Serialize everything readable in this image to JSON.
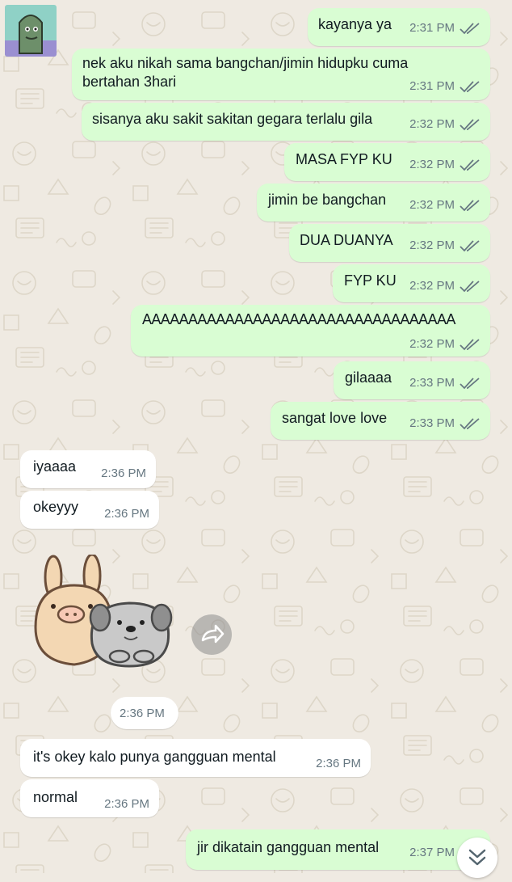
{
  "messages": [
    {
      "id": "m1",
      "dir": "out",
      "text": "kayanya ya",
      "time": "2:31 PM",
      "status": "read"
    },
    {
      "id": "m2",
      "dir": "out",
      "lines": [
        "nek aku nikah sama bangchan/jimin hidupku cuma",
        "bertahan 3hari"
      ],
      "time": "2:31 PM",
      "status": "read"
    },
    {
      "id": "m3",
      "dir": "out",
      "text": "sisanya aku sakit sakitan gegara terlalu gila",
      "time": "2:32 PM",
      "status": "read"
    },
    {
      "id": "m4",
      "dir": "out",
      "text": "MASA FYP KU",
      "time": "2:32 PM",
      "status": "read"
    },
    {
      "id": "m5",
      "dir": "out",
      "text": "jimin be bangchan",
      "time": "2:32 PM",
      "status": "read"
    },
    {
      "id": "m6",
      "dir": "out",
      "text": "DUA DUANYA",
      "time": "2:32 PM",
      "status": "read"
    },
    {
      "id": "m7",
      "dir": "out",
      "text": "FYP KU",
      "time": "2:32 PM",
      "status": "read"
    },
    {
      "id": "m8",
      "dir": "out",
      "text": "AAAAAAAAAAAAAAAAAAAAAAAAAAAAAAAAAA",
      "time": "2:32 PM",
      "status": "read"
    },
    {
      "id": "m9",
      "dir": "out",
      "text": "gilaaaa",
      "time": "2:33 PM",
      "status": "read"
    },
    {
      "id": "m10",
      "dir": "out",
      "text": "sangat love love",
      "time": "2:33 PM",
      "status": "read"
    },
    {
      "id": "m11",
      "dir": "in",
      "text": "iyaaaa",
      "time": "2:36 PM"
    },
    {
      "id": "m12",
      "dir": "in",
      "text": "okeyyy",
      "time": "2:36 PM"
    },
    {
      "id": "m13",
      "dir": "in",
      "type": "sticker",
      "sticker": "bunny-and-dog-sticker",
      "time": "2:36 PM"
    },
    {
      "id": "m14",
      "dir": "in",
      "text": "it's okey kalo punya gangguan mental",
      "time": "2:36 PM"
    },
    {
      "id": "m15",
      "dir": "in",
      "text": "normal",
      "time": "2:36 PM"
    },
    {
      "id": "m16",
      "dir": "out",
      "text": "jir dikatain gangguan mental",
      "time": "2:37 PM",
      "status": "read"
    }
  ],
  "icons": {
    "avatar": "contact-avatar-icon",
    "forward": "forward-icon",
    "scroll": "chevron-double-down-icon",
    "tick": "double-check-icon"
  },
  "colors": {
    "outgoing_bubble": "#d9fdd3",
    "incoming_bubble": "#ffffff",
    "background": "#efeae2",
    "tick": "#667781",
    "meta_text": "#667781"
  }
}
